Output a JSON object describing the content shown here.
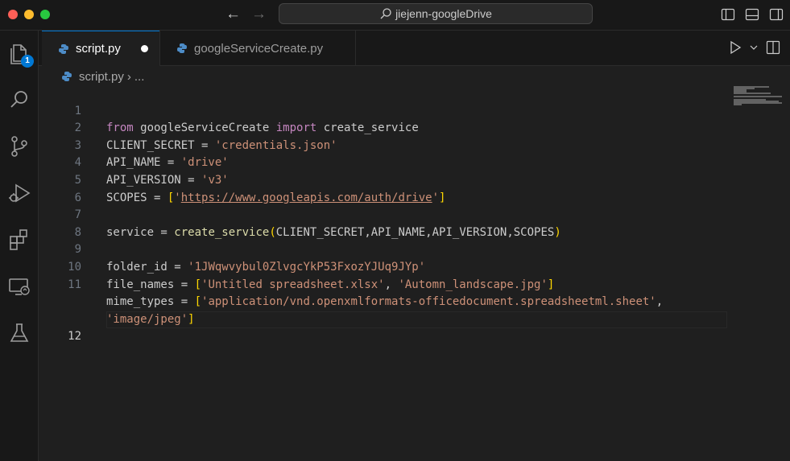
{
  "window": {
    "search_text": "jiejenn-googleDrive"
  },
  "activity_bar": {
    "explorer_badge": "1"
  },
  "tabs": [
    {
      "label": "script.py",
      "dirty": true
    },
    {
      "label": "googleServiceCreate.py",
      "dirty": false
    }
  ],
  "breadcrumb": {
    "file": "script.py",
    "sep": "›",
    "more": "..."
  },
  "editor": {
    "current_line": 12,
    "line_numbers": [
      "1",
      "2",
      "3",
      "4",
      "5",
      "6",
      "7",
      "8",
      "9",
      "10",
      "11",
      "",
      "12"
    ],
    "code": {
      "l1": {
        "from": "from",
        "module": " googleServiceCreate ",
        "import": "import",
        "name": " create_service"
      },
      "l2": {
        "var": "CLIENT_SECRET = ",
        "value": "'credentials.json'"
      },
      "l3": {
        "var": "API_NAME = ",
        "value": "'drive'"
      },
      "l4": {
        "var": "API_VERSION = ",
        "value": "'v3'"
      },
      "l5": {
        "var": "SCOPES = ",
        "open": "[",
        "q1": "'",
        "url": "https://www.googleapis.com/auth/drive",
        "q2": "'",
        "close": "]"
      },
      "l7": {
        "var": "service = ",
        "fn": "create_service",
        "open": "(",
        "args": "CLIENT_SECRET,API_NAME,API_VERSION,SCOPES",
        "close": ")"
      },
      "l9": {
        "var": "folder_id = ",
        "value": "'1JWqwvybul0ZlvgcYkP53FxozYJUq9JYp'"
      },
      "l10": {
        "var": "file_names = ",
        "open": "[",
        "v1": "'Untitled spreadsheet.xlsx'",
        "comma": ", ",
        "v2": "'Automn_landscape.jpg'",
        "close": "]"
      },
      "l11": {
        "var": "mime_types = ",
        "open": "[",
        "v1": "'application/vnd.openxmlformats-officedocument.spreadsheetml.sheet'",
        "comma": ","
      },
      "l11b": {
        "v2": "'image/jpeg'",
        "close": "]"
      }
    }
  },
  "colors": {
    "keyword": "#c586c0",
    "function": "#dcdcaa",
    "string": "#ce9178",
    "bracket": "#ffd700",
    "accent": "#0078d4"
  }
}
